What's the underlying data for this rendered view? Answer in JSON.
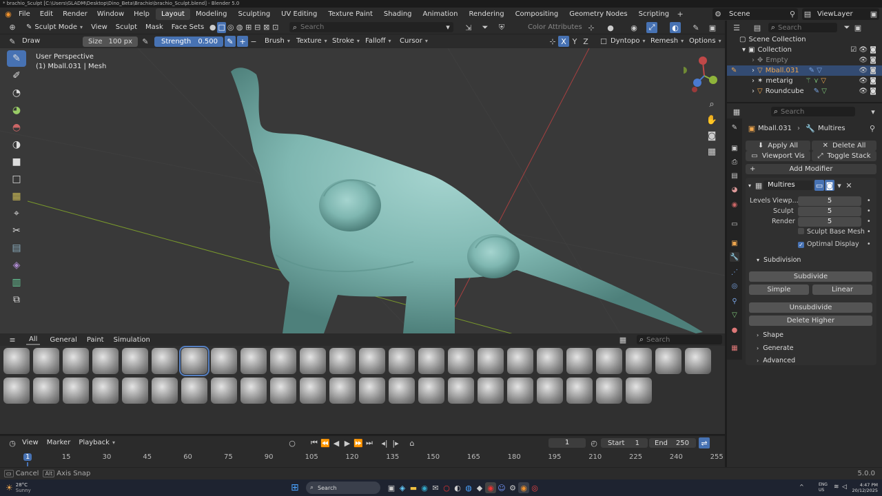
{
  "window_title": "* brachio_Sculpt [C:\\Users\\GLADM\\Desktop\\Dino_Beta\\Brachio\\brachio_Sculpt.blend] - Blender 5.0",
  "menu": [
    "File",
    "Edit",
    "Render",
    "Window",
    "Help"
  ],
  "workspaces": [
    "Layout",
    "Modeling",
    "Sculpting",
    "UV Editing",
    "Texture Paint",
    "Shading",
    "Animation",
    "Rendering",
    "Compositing",
    "Geometry Nodes",
    "Scripting"
  ],
  "active_workspace": "Layout",
  "scene": {
    "label": "Scene",
    "view_layer": "ViewLayer"
  },
  "header1": {
    "mode": "Sculpt Mode",
    "view": "View",
    "sculpt": "Sculpt",
    "mask": "Mask",
    "face_sets": "Face Sets",
    "search_placeholder": "Search",
    "color_attributes": "Color Attributes"
  },
  "header2": {
    "brush_name": "Draw",
    "size_label": "Size",
    "size_value": "100 px",
    "strength_label": "Strength",
    "strength_value": "0.500",
    "brush": "Brush",
    "texture": "Texture",
    "stroke": "Stroke",
    "falloff": "Falloff",
    "cursor": "Cursor",
    "x": "X",
    "y": "Y",
    "z": "Z",
    "dyntopo": "Dyntopo",
    "remesh": "Remesh",
    "options": "Options"
  },
  "viewport": {
    "perspective": "User Perspective",
    "object_info": "(1) Mball.031 | Mesh"
  },
  "asset_shelf": {
    "tabs": [
      "All",
      "General",
      "Paint",
      "Simulation"
    ],
    "active": "All",
    "search_placeholder": "Search",
    "brush_count": 46
  },
  "timeline": {
    "view": "View",
    "marker": "Marker",
    "playback": "Playback",
    "current_frame": "1",
    "start_label": "Start",
    "start": "1",
    "end_label": "End",
    "end": "250",
    "ticks": [
      "1",
      "15",
      "30",
      "45",
      "60",
      "75",
      "90",
      "105",
      "120",
      "135",
      "150",
      "165",
      "180",
      "195",
      "210",
      "225",
      "240",
      "255"
    ]
  },
  "status": {
    "cancel": "Cancel",
    "alt": "Alt",
    "axis_snap": "Axis Snap",
    "version": "5.0.0"
  },
  "outliner": {
    "search_placeholder": "Search",
    "scene_collection": "Scene Collection",
    "collection": "Collection",
    "items": [
      "Empty",
      "Mball.031",
      "metarig",
      "Roundcube"
    ]
  },
  "properties": {
    "search_placeholder": "Search",
    "breadcrumb_object": "Mball.031",
    "breadcrumb_modifier": "Multires",
    "apply_all": "Apply All",
    "delete_all": "Delete All",
    "viewport_vis": "Viewport Vis",
    "toggle_stack": "Toggle Stack",
    "add_modifier": "Add Modifier",
    "modifier_name": "Multires",
    "levels_viewport_label": "Levels Viewp...",
    "levels_viewport": "5",
    "sculpt_label": "Sculpt",
    "sculpt": "5",
    "render_label": "Render",
    "render": "5",
    "sculpt_base_mesh": "Sculpt Base Mesh",
    "optimal_display": "Optimal Display",
    "subdivision": "Subdivision",
    "subdivide": "Subdivide",
    "simple": "Simple",
    "linear": "Linear",
    "unsubdivide": "Unsubdivide",
    "delete_higher": "Delete Higher",
    "shape": "Shape",
    "generate": "Generate",
    "advanced": "Advanced"
  },
  "taskbar": {
    "temp": "28°C",
    "weather": "Sunny",
    "search": "Search",
    "lang": "ENG",
    "region": "US",
    "time": "4:47 PM",
    "date": "20/12/2025"
  },
  "colors": {
    "accent": "#4772b3",
    "mesh": "#7fb7b1",
    "x_axis": "#c04848",
    "y_axis": "#8fb43b",
    "z_axis": "#4a7ad0"
  }
}
